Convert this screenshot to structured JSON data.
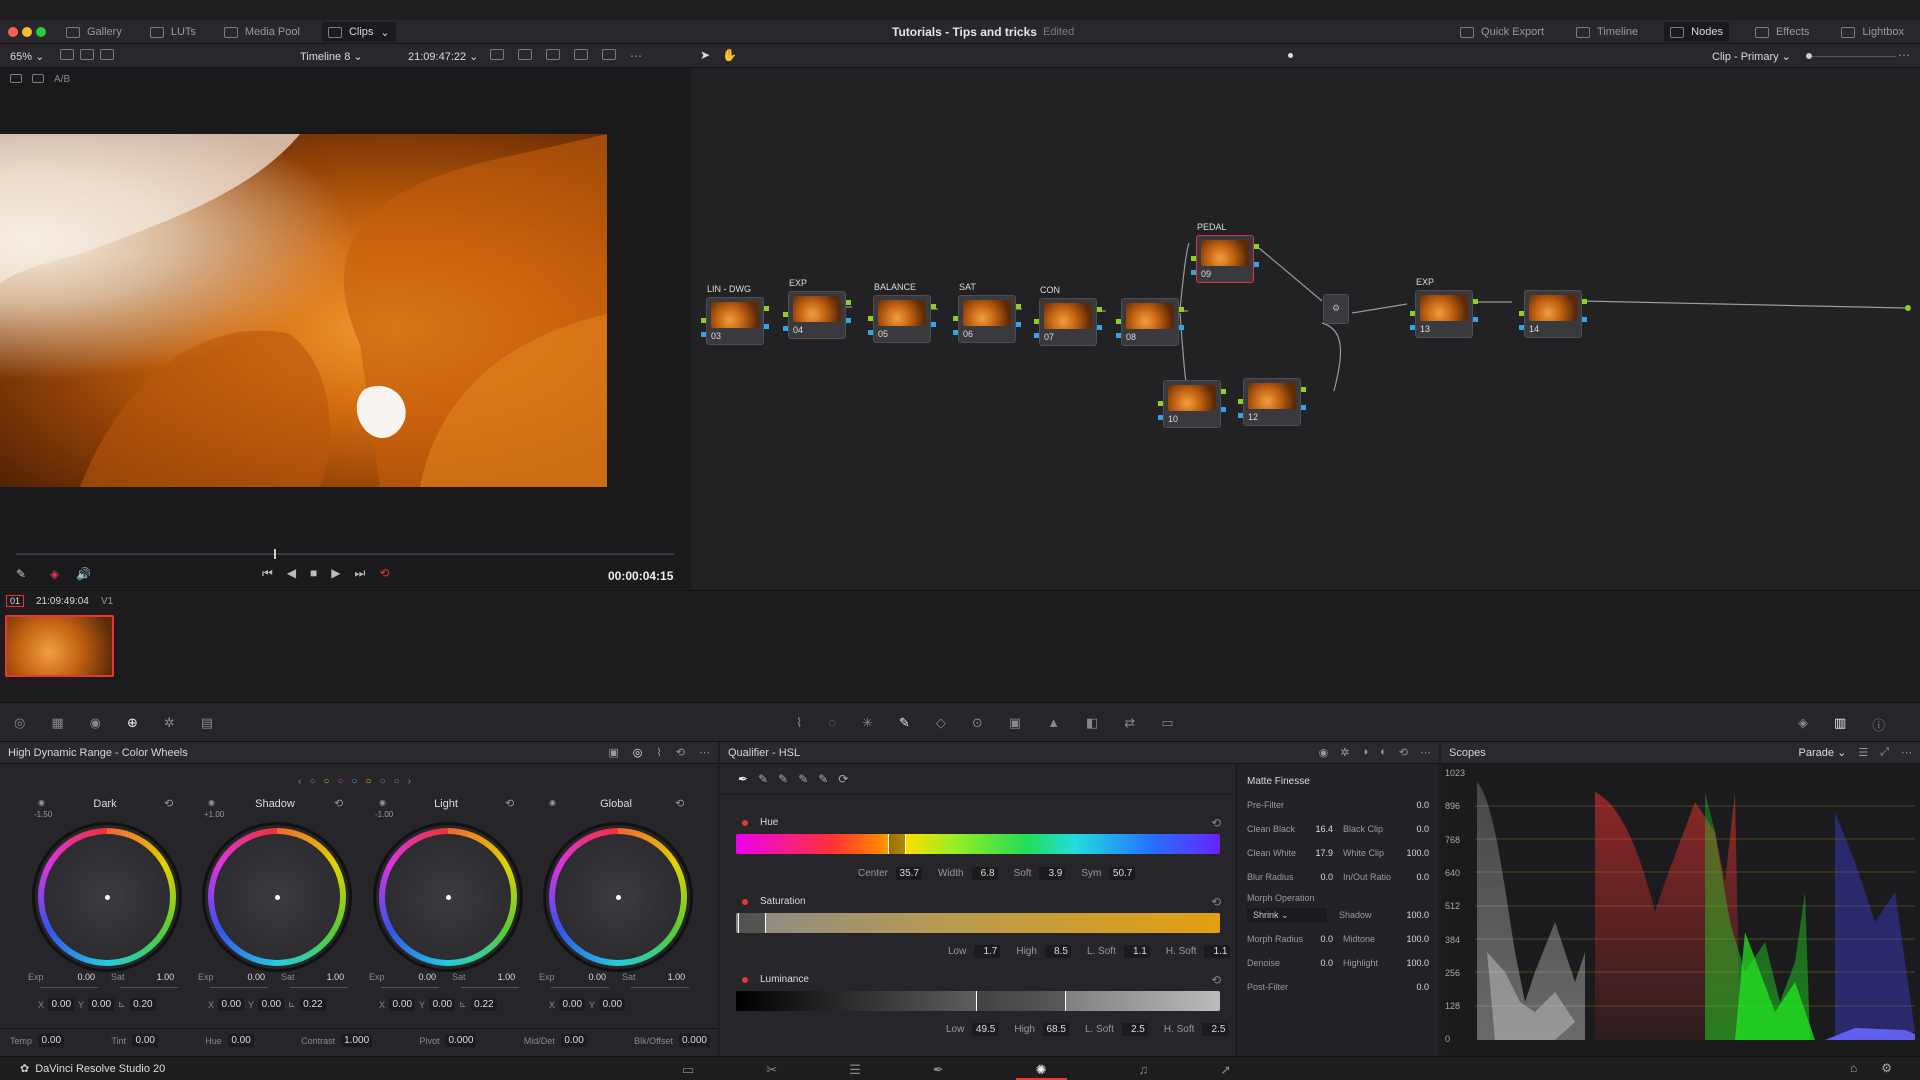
{
  "app": {
    "title": "Tutorials - Tips and tricks",
    "status": "Edited",
    "product": "DaVinci Resolve Studio 20"
  },
  "top_tabs": {
    "left": [
      "Gallery",
      "LUTs",
      "Media Pool",
      "Clips"
    ],
    "right": [
      "Quick Export",
      "Timeline",
      "Nodes",
      "Effects",
      "Lightbox"
    ]
  },
  "viewer": {
    "zoom": "65%",
    "timeline": "Timeline 8",
    "timecode": "21:09:47:22",
    "ab_label": "A/B",
    "playhead_time": "00:00:04:15",
    "clip_mode": "Clip - Primary"
  },
  "clip": {
    "index": "01",
    "timecode": "21:09:49:04",
    "track": "V1"
  },
  "nodes": [
    {
      "num": "03",
      "label": "LIN - DWG"
    },
    {
      "num": "04",
      "label": "EXP"
    },
    {
      "num": "05",
      "label": "BALANCE"
    },
    {
      "num": "06",
      "label": "SAT"
    },
    {
      "num": "07",
      "label": "CON"
    },
    {
      "num": "08",
      "label": ""
    },
    {
      "num": "09",
      "label": "PEDAL"
    },
    {
      "num": "10",
      "label": ""
    },
    {
      "num": "12",
      "label": ""
    },
    {
      "num": "13",
      "label": "EXP"
    },
    {
      "num": "14",
      "label": ""
    }
  ],
  "color_wheels": {
    "title": "High Dynamic Range - Color Wheels",
    "wheels": [
      {
        "name": "Dark",
        "preset": "-1.50",
        "exp": "0.00",
        "sat": "1.00",
        "x": "0.00",
        "y": "0.00",
        "z": "0.20"
      },
      {
        "name": "Shadow",
        "preset": "+1.00",
        "exp": "0.00",
        "sat": "1.00",
        "x": "0.00",
        "y": "0.00",
        "z": "0.22"
      },
      {
        "name": "Light",
        "preset": "-1.00",
        "exp": "0.00",
        "sat": "1.00",
        "x": "0.00",
        "y": "0.00",
        "z": "0.22"
      },
      {
        "name": "Global",
        "preset": "",
        "exp": "0.00",
        "sat": "1.00",
        "x": "0.00",
        "y": "0.00",
        "z": ""
      }
    ],
    "exp_label": "Exp",
    "sat_label": "Sat",
    "bottom": [
      {
        "label": "Temp",
        "value": "0.00"
      },
      {
        "label": "Tint",
        "value": "0.00"
      },
      {
        "label": "Hue",
        "value": "0.00"
      },
      {
        "label": "Contrast",
        "value": "1.000"
      },
      {
        "label": "Pivot",
        "value": "0.000"
      },
      {
        "label": "Mid/Det",
        "value": "0.00"
      },
      {
        "label": "Blk/Offset",
        "value": "0.000"
      }
    ]
  },
  "qualifier": {
    "title": "Qualifier - HSL",
    "hue": {
      "label": "Hue",
      "center": "35.7",
      "width": "6.8",
      "soft": "3.9",
      "sym": "50.7"
    },
    "saturation": {
      "label": "Saturation",
      "low": "1.7",
      "high": "8.5",
      "lsoft": "1.1",
      "hsoft": "1.1"
    },
    "luminance": {
      "label": "Luminance",
      "low": "49.5",
      "high": "68.5",
      "lsoft": "2.5",
      "hsoft": "2.5"
    },
    "field_labels": {
      "center": "Center",
      "width": "Width",
      "soft": "Soft",
      "sym": "Sym",
      "low": "Low",
      "high": "High",
      "lsoft": "L. Soft",
      "hsoft": "H. Soft"
    }
  },
  "matte_finesse": {
    "title": "Matte Finesse",
    "pre_filter": {
      "label": "Pre-Filter",
      "value": "0.0"
    },
    "rows": [
      [
        {
          "label": "Clean Black",
          "value": "16.4"
        },
        {
          "label": "Black Clip",
          "value": "0.0"
        }
      ],
      [
        {
          "label": "Clean White",
          "value": "17.9"
        },
        {
          "label": "White Clip",
          "value": "100.0"
        }
      ],
      [
        {
          "label": "Blur Radius",
          "value": "0.0"
        },
        {
          "label": "In/Out Ratio",
          "value": "0.0"
        }
      ]
    ],
    "morph_label": "Morph Operation",
    "morph_value": "Shrink",
    "rows2": [
      [
        {
          "label": "Shadow",
          "value": "100.0"
        }
      ],
      [
        {
          "label": "Morph Radius",
          "value": "0.0"
        },
        {
          "label": "Midtone",
          "value": "100.0"
        }
      ],
      [
        {
          "label": "Denoise",
          "value": "0.0"
        },
        {
          "label": "Highlight",
          "value": "100.0"
        }
      ]
    ],
    "post_filter": {
      "label": "Post-Filter",
      "value": "0.0"
    }
  },
  "scopes": {
    "title": "Scopes",
    "mode": "Parade",
    "ticks": [
      "1023",
      "896",
      "768",
      "640",
      "512",
      "384",
      "256",
      "128",
      "0"
    ]
  }
}
